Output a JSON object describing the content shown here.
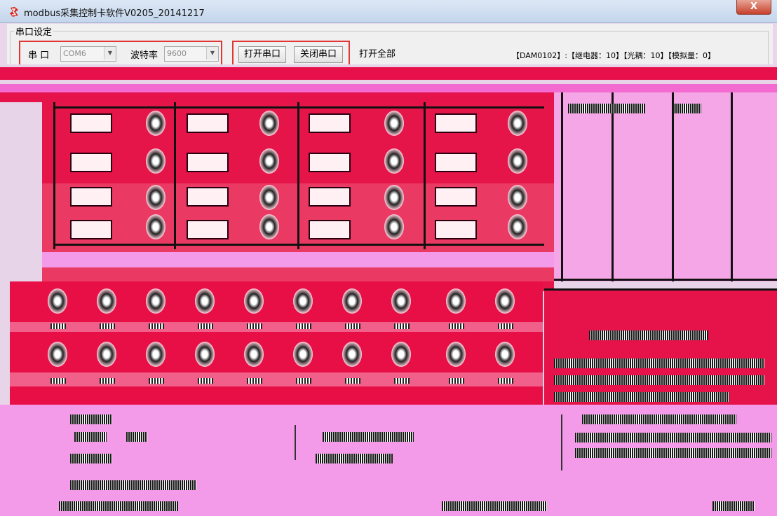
{
  "window": {
    "title": "modbus采集控制卡软件V0205_20141217",
    "close_label": "X"
  },
  "settings": {
    "group_title": "串口设定",
    "port_label": "串  口",
    "port_value": "COM6",
    "baud_label": "波特率",
    "baud_value": "9600",
    "open_port_button": "打开串口",
    "close_port_button": "关闭串口",
    "open_all_button": "打开全部",
    "status_text": "【DAM0102】:【继电器：10】【光耦：10】【模拟量：0】"
  },
  "colors": {
    "red_band": "#e3123f",
    "pink_band": "#f39be8",
    "highlight_red": "#e23636"
  }
}
